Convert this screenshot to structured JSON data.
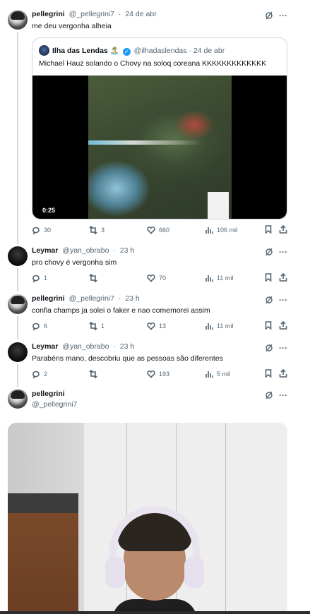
{
  "tweets": [
    {
      "display_name": "pellegrini",
      "handle": "@_pellegrini7",
      "time": "24 de abr",
      "text": "me deu vergonha alheia",
      "quote": {
        "display_name": "Ilha das Lendas",
        "emoji": "🏝️",
        "handle": "@ilhadaslendas",
        "time": "24 de abr",
        "text": "Michael Hauz solando o Chovy na soloq coreana KKKKKKKKKKKKK",
        "video_duration": "0:25"
      },
      "replies": "30",
      "retweets": "3",
      "likes": "660",
      "views": "106 mil"
    },
    {
      "display_name": "Leymar",
      "handle": "@yan_obrabo",
      "time": "23 h",
      "text": "pro chovy é vergonha sim",
      "replies": "1",
      "retweets": "",
      "likes": "70",
      "views": "11 mil"
    },
    {
      "display_name": "pellegrini",
      "handle": "@_pellegrini7",
      "time": "23 h",
      "text": "confia champs ja solei o faker e nao comemorei assim",
      "replies": "6",
      "retweets": "1",
      "likes": "13",
      "views": "11 mil"
    },
    {
      "display_name": "Leymar",
      "handle": "@yan_obrabo",
      "time": "23 h",
      "text": "Parabéns mano, descobriu que as pessoas são diferentes",
      "replies": "2",
      "retweets": "",
      "likes": "193",
      "views": "5 mil"
    }
  ],
  "focused": {
    "display_name": "pellegrini",
    "handle": "@_pellegrini7"
  },
  "icons": {
    "grok": "grok-icon",
    "more": "more-icon",
    "reply": "reply-icon",
    "retweet": "retweet-icon",
    "like": "heart-icon",
    "views": "views-icon",
    "bookmark": "bookmark-icon",
    "share": "share-icon"
  },
  "more_glyph": "···",
  "colors": {
    "verified": "#1d9bf0",
    "muted": "#536471",
    "text": "#0f1419"
  }
}
